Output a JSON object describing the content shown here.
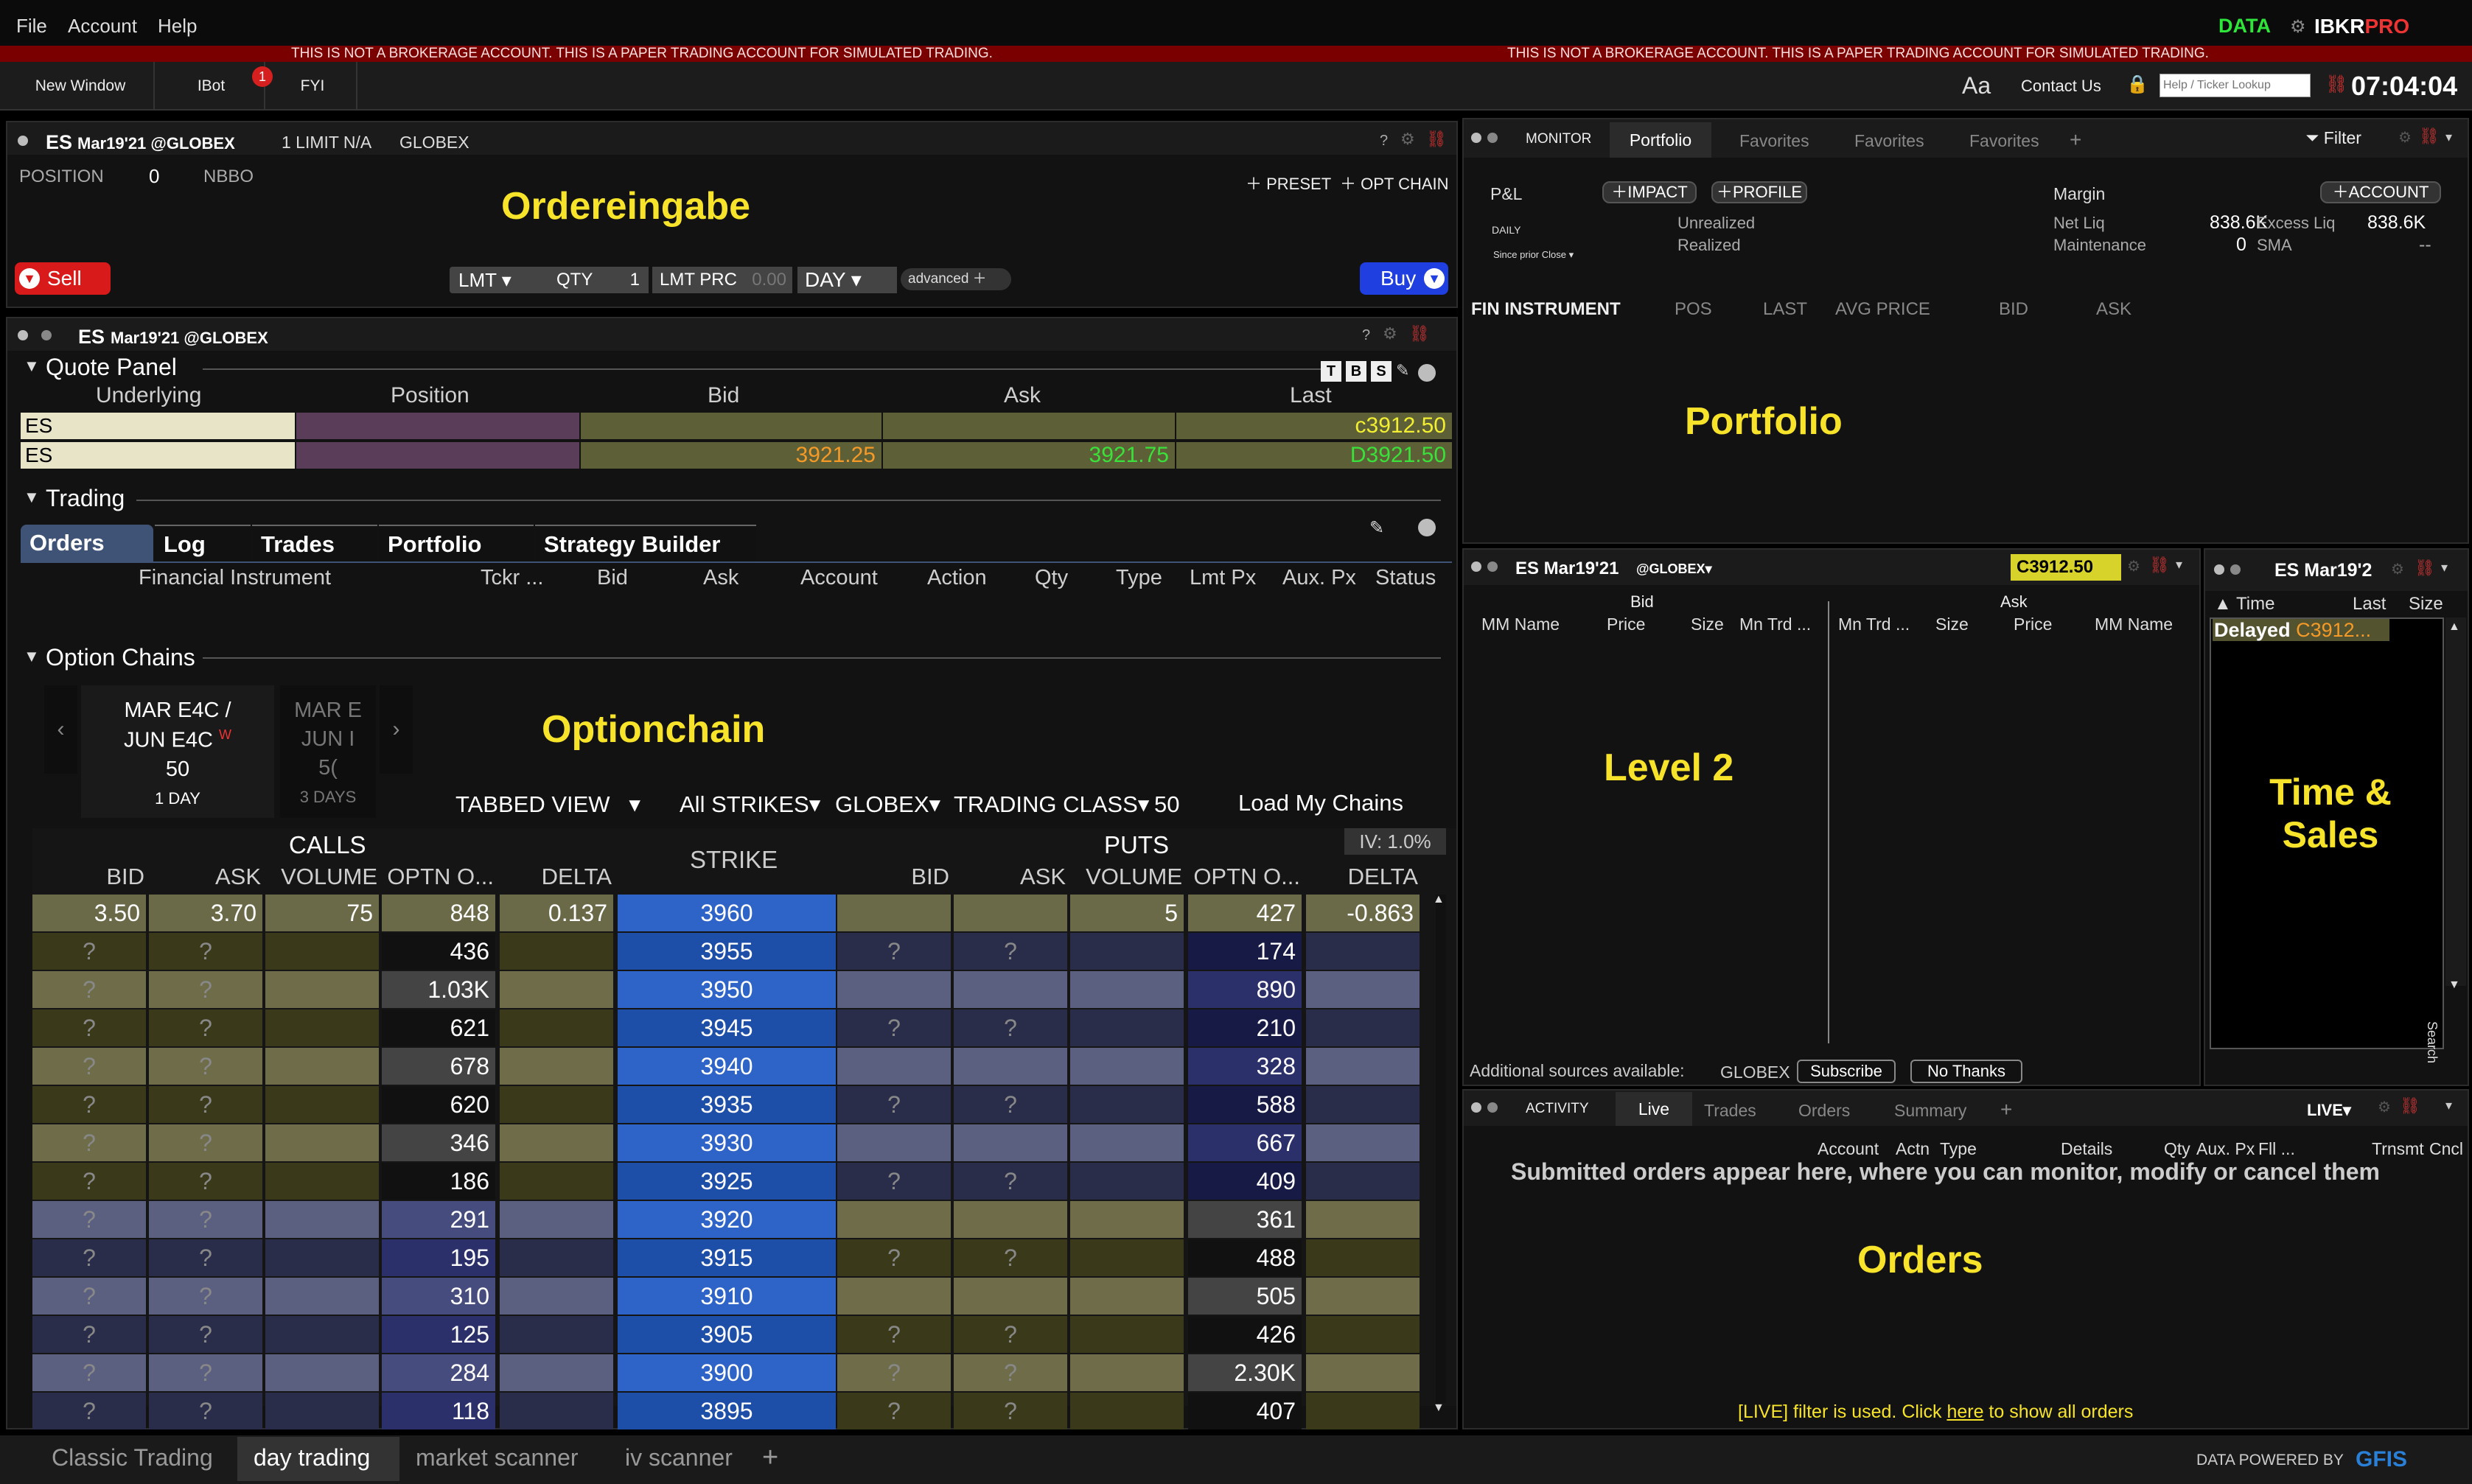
{
  "menu": {
    "file": "File",
    "account": "Account",
    "help": "Help",
    "data": "DATA",
    "brand_ib": "IBKR",
    "brand_pro": "PRO"
  },
  "warning": "THIS IS NOT A BROKERAGE ACCOUNT. THIS IS A PAPER TRADING ACCOUNT FOR SIMULATED TRADING.",
  "toolbar": {
    "new_window": "New Window",
    "ibot": "IBot",
    "ibot_badge": "1",
    "fyi": "FYI",
    "aa": "Aa",
    "contact": "Contact Us",
    "lookup_placeholder": "Help / Ticker Lookup",
    "clock": "07:04:04"
  },
  "order_entry": {
    "symbol": "ES",
    "contract": "Mar19'21 @GLOBEX",
    "info1": "1 LIMIT N/A",
    "info2": "GLOBEX",
    "position_label": "POSITION",
    "position_value": "0",
    "nbbo": "NBBO",
    "title": "Ordereingabe",
    "preset": "PRESET",
    "opt_chain": "OPT CHAIN",
    "sell": "Sell",
    "buy": "Buy",
    "lmt": "LMT",
    "qty_label": "QTY",
    "qty_value": "1",
    "lmt_prc_label": "LMT PRC",
    "lmt_prc_value": "0.00",
    "day": "DAY",
    "advanced": "advanced",
    "help": "?"
  },
  "quote": {
    "symbol": "ES",
    "contract": "Mar19'21 @GLOBEX",
    "section": "Quote Panel",
    "cols": [
      "Underlying",
      "Position",
      "Bid",
      "Ask",
      "Last"
    ],
    "badges": [
      "T",
      "B",
      "S"
    ],
    "rows": [
      {
        "u": "ES",
        "pos": "",
        "bid": "",
        "ask": "",
        "last": "c3912.50"
      },
      {
        "u": "ES",
        "pos": "",
        "bid": "3921.25",
        "ask": "3921.75",
        "last": "D3921.50"
      }
    ]
  },
  "trading": {
    "section": "Trading",
    "tabs": [
      "Orders",
      "Log",
      "Trades",
      "Portfolio",
      "Strategy Builder"
    ],
    "cols": [
      "Financial Instrument",
      "Tckr ...",
      "Bid",
      "Ask",
      "Account",
      "Action",
      "Qty",
      "Type",
      "Lmt Px",
      "Aux. Px",
      "Status"
    ]
  },
  "chain": {
    "section": "Option Chains",
    "title": "Optionchain",
    "exp1_l1": "MAR E4C /",
    "exp1_l2": "JUN E4C",
    "exp1_w": "W",
    "exp1_num": "50",
    "exp1_days": "1 DAY",
    "exp2_l1": "MAR E",
    "exp2_l2": "JUN I",
    "exp2_num": "5(",
    "exp2_days": "3 DAYS",
    "view": "TABBED VIEW",
    "strikes": "All STRIKES",
    "exch": "GLOBEX",
    "tclass": "TRADING CLASS",
    "tclass_val": "50",
    "load": "Load My Chains",
    "iv": "IV: 1.0%",
    "calls": "CALLS",
    "puts": "PUTS",
    "strike": "STRIKE",
    "cols_call": [
      "BID",
      "ASK",
      "VOLUME",
      "OPTN O...",
      "DELTA"
    ],
    "cols_put": [
      "BID",
      "ASK",
      "VOLUME",
      "OPTN O...",
      "DELTA"
    ],
    "rows": [
      {
        "strike": "3960",
        "cb": "3.50",
        "ca": "3.70",
        "cv": "75",
        "co": "848",
        "cd": "0.137",
        "pb": "",
        "pa": "",
        "pv": "5",
        "po": "427",
        "pd": "-0.863"
      },
      {
        "strike": "3955",
        "cb": "?",
        "ca": "?",
        "cv": "",
        "co": "436",
        "cd": "",
        "pb": "?",
        "pa": "?",
        "pv": "",
        "po": "174",
        "pd": ""
      },
      {
        "strike": "3950",
        "cb": "?",
        "ca": "?",
        "cv": "",
        "co": "1.03K",
        "cd": "",
        "pb": "",
        "pa": "",
        "pv": "",
        "po": "890",
        "pd": ""
      },
      {
        "strike": "3945",
        "cb": "?",
        "ca": "?",
        "cv": "",
        "co": "621",
        "cd": "",
        "pb": "?",
        "pa": "?",
        "pv": "",
        "po": "210",
        "pd": ""
      },
      {
        "strike": "3940",
        "cb": "?",
        "ca": "?",
        "cv": "",
        "co": "678",
        "cd": "",
        "pb": "",
        "pa": "",
        "pv": "",
        "po": "328",
        "pd": ""
      },
      {
        "strike": "3935",
        "cb": "?",
        "ca": "?",
        "cv": "",
        "co": "620",
        "cd": "",
        "pb": "?",
        "pa": "?",
        "pv": "",
        "po": "588",
        "pd": ""
      },
      {
        "strike": "3930",
        "cb": "?",
        "ca": "?",
        "cv": "",
        "co": "346",
        "cd": "",
        "pb": "",
        "pa": "",
        "pv": "",
        "po": "667",
        "pd": ""
      },
      {
        "strike": "3925",
        "cb": "?",
        "ca": "?",
        "cv": "",
        "co": "186",
        "cd": "",
        "pb": "?",
        "pa": "?",
        "pv": "",
        "po": "409",
        "pd": ""
      },
      {
        "strike": "3920",
        "cb": "?",
        "ca": "?",
        "cv": "",
        "co": "291",
        "cd": "",
        "pb": "",
        "pa": "",
        "pv": "",
        "po": "361",
        "pd": ""
      },
      {
        "strike": "3915",
        "cb": "?",
        "ca": "?",
        "cv": "",
        "co": "195",
        "cd": "",
        "pb": "?",
        "pa": "?",
        "pv": "",
        "po": "488",
        "pd": ""
      },
      {
        "strike": "3910",
        "cb": "?",
        "ca": "?",
        "cv": "",
        "co": "310",
        "cd": "",
        "pb": "",
        "pa": "",
        "pv": "",
        "po": "505",
        "pd": ""
      },
      {
        "strike": "3905",
        "cb": "?",
        "ca": "?",
        "cv": "",
        "co": "125",
        "cd": "",
        "pb": "?",
        "pa": "?",
        "pv": "",
        "po": "426",
        "pd": ""
      },
      {
        "strike": "3900",
        "cb": "?",
        "ca": "?",
        "cv": "",
        "co": "284",
        "cd": "",
        "pb": "?",
        "pa": "?",
        "pv": "",
        "po": "2.30K",
        "pd": ""
      },
      {
        "strike": "3895",
        "cb": "?",
        "ca": "?",
        "cv": "",
        "co": "118",
        "cd": "",
        "pb": "?",
        "pa": "?",
        "pv": "",
        "po": "407",
        "pd": ""
      }
    ]
  },
  "monitor": {
    "label": "MONITOR",
    "tabs": [
      "Portfolio",
      "Favorites",
      "Favorites",
      "Favorites"
    ],
    "filter": "Filter",
    "pnl": "P&L",
    "impact": "IMPACT",
    "profile": "PROFILE",
    "account_btn": "ACCOUNT",
    "daily": "DAILY",
    "since": "Since prior Close",
    "unrealized": "Unrealized",
    "realized": "Realized",
    "margin": "Margin",
    "netliq_l": "Net Liq",
    "netliq_v": "838.6K",
    "excess_l": "Excess Liq",
    "excess_v": "838.6K",
    "maint_l": "Maintenance",
    "maint_v": "0",
    "sma_l": "SMA",
    "sma_v": "--",
    "cols": [
      "FIN INSTRUMENT",
      "POS",
      "LAST",
      "AVG PRICE",
      "BID",
      "ASK"
    ],
    "title": "Portfolio"
  },
  "level2": {
    "contract": "ES Mar19'21",
    "exch": "@GLOBEX",
    "price": "C3912.50",
    "bid": "Bid",
    "ask": "Ask",
    "cols": [
      "MM Name",
      "Price",
      "Size",
      "Mn Trd ...",
      "Mn Trd ...",
      "Size",
      "Price",
      "MM Name"
    ],
    "title": "Level 2",
    "sources": "Additional sources available:",
    "sources_exch": "GLOBEX",
    "subscribe": "Subscribe",
    "nothanks": "No Thanks"
  },
  "ts": {
    "contract": "ES Mar19'2",
    "time": "Time",
    "last": "Last",
    "size": "Size",
    "delayed": "Delayed",
    "delayed_val": "C3912...",
    "title1": "Time &",
    "title2": "Sales",
    "search": "Search"
  },
  "activity": {
    "label": "ACTIVITY",
    "tabs": [
      "Live",
      "Trades",
      "Orders",
      "Summary"
    ],
    "live": "LIVE",
    "cols": [
      "Account",
      "Actn",
      "Type",
      "Details",
      "Qty",
      "Aux. Px",
      "Fll ...",
      "Trnsmt",
      "Cncl"
    ],
    "message": "Submitted orders appear here, where you can monitor, modify or cancel them",
    "title": "Orders",
    "filter_pre": "[LIVE] filter is used. Click ",
    "filter_link": "here",
    "filter_post": " to show all orders"
  },
  "bottom": {
    "tabs": [
      "Classic Trading",
      "day trading",
      "market scanner",
      "iv scanner"
    ],
    "powered": "DATA POWERED BY",
    "gfis": "GFIS"
  }
}
